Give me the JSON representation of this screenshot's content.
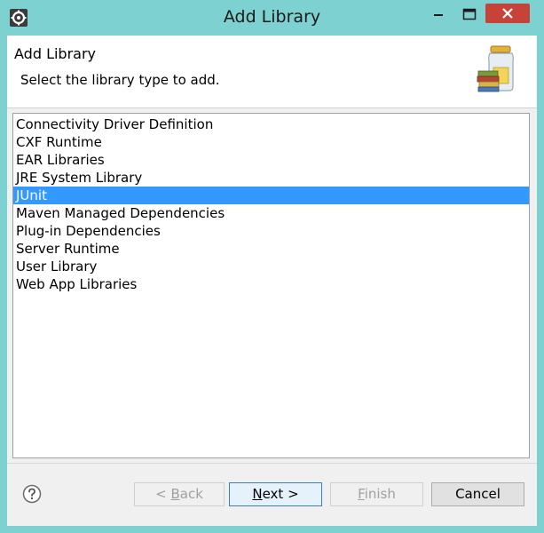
{
  "window": {
    "title": "Add Library"
  },
  "header": {
    "title": "Add Library",
    "description": "Select the library type to add."
  },
  "library_list": {
    "items": [
      "Connectivity Driver Definition",
      "CXF Runtime",
      "EAR Libraries",
      "JRE System Library",
      "JUnit",
      "Maven Managed Dependencies",
      "Plug-in Dependencies",
      "Server Runtime",
      "User Library",
      "Web App Libraries"
    ],
    "selected": "JUnit"
  },
  "buttons": {
    "back_prefix": "< ",
    "back_accel": "B",
    "back_rest": "ack",
    "next_accel": "N",
    "next_rest": "ext >",
    "finish_accel": "F",
    "finish_rest": "inish",
    "cancel": "Cancel"
  },
  "colors": {
    "frame": "#7dd1d1",
    "selection": "#3399ff",
    "close_button": "#c7433a"
  },
  "icons": {
    "app": "eclipse-gear-icon",
    "banner": "library-jar-books-icon",
    "help": "help-question-icon",
    "minimize": "minimize-icon",
    "maximize": "maximize-icon",
    "close": "close-icon"
  }
}
